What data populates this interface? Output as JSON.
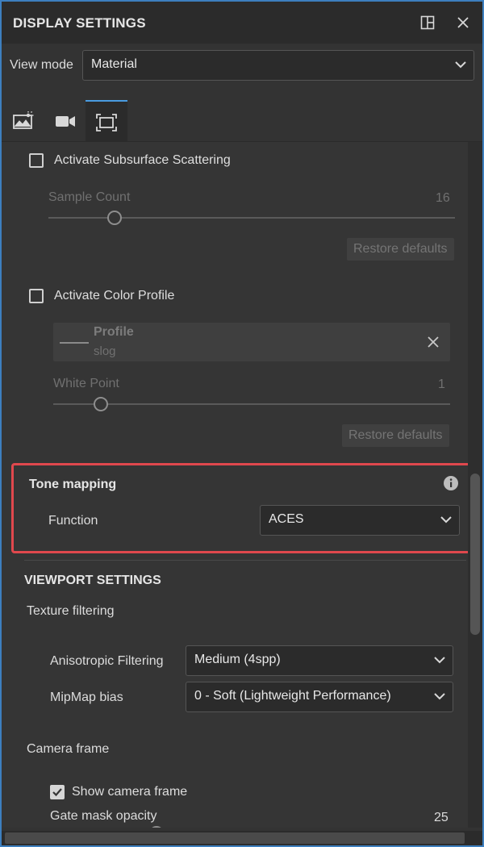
{
  "window": {
    "title": "DISPLAY SETTINGS",
    "dock_icon": "dock-icon",
    "close_icon": "close-icon"
  },
  "view_mode": {
    "label": "View mode",
    "value": "Material"
  },
  "tabs": [
    {
      "icon": "environment-icon",
      "active": false
    },
    {
      "icon": "camera-icon",
      "active": false
    },
    {
      "icon": "viewport-frame-icon",
      "active": true
    }
  ],
  "subsurface": {
    "checkbox_label": "Activate Subsurface Scattering",
    "checked": false,
    "sample_count_label": "Sample Count",
    "sample_count_value": "16",
    "restore_label": "Restore defaults"
  },
  "color_profile": {
    "checkbox_label": "Activate Color Profile",
    "checked": false,
    "profile_title": "Profile",
    "profile_name": "slog",
    "white_point_label": "White Point",
    "white_point_value": "1",
    "restore_label": "Restore defaults"
  },
  "tone_mapping": {
    "title": "Tone mapping",
    "function_label": "Function",
    "function_value": "ACES",
    "highlight_color": "#e0484d"
  },
  "viewport_settings": {
    "title": "VIEWPORT SETTINGS",
    "texture_filtering_label": "Texture filtering",
    "aniso_label": "Anisotropic Filtering",
    "aniso_value": "Medium (4spp)",
    "mipmap_label": "MipMap bias",
    "mipmap_value": "0 - Soft (Lightweight Performance)",
    "camera_frame_label": "Camera frame",
    "show_camera_frame_label": "Show camera frame",
    "show_camera_frame_checked": true,
    "gate_mask_label": "Gate mask opacity",
    "gate_mask_value": "25"
  },
  "colors": {
    "accent": "#4a9be0",
    "panel_bg": "#353535",
    "title_bg": "#2b2b2b"
  }
}
